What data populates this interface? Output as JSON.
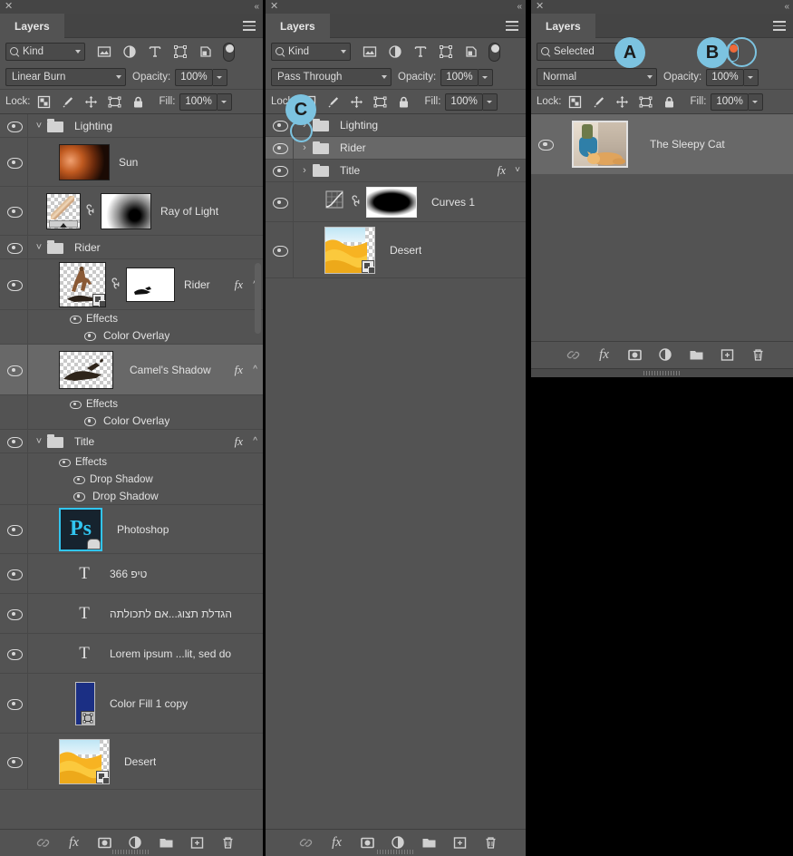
{
  "panels": [
    {
      "id": "panel1",
      "titlebar": {
        "close": "✕",
        "collapse": "«"
      },
      "tab": {
        "label": "Layers",
        "menu_icon": "hamburger-menu-icon"
      },
      "filter": {
        "kind_label": "Kind",
        "search_icon": "search-icon",
        "icons": [
          "pixel-layer-filter-icon",
          "adjustment-layer-filter-icon",
          "type-layer-filter-icon",
          "shape-layer-filter-icon",
          "smart-object-filter-icon"
        ],
        "toggle_on": false
      },
      "blend": {
        "mode": "Linear Burn",
        "opacity_label": "Opacity:",
        "opacity_value": "100%"
      },
      "lock": {
        "label": "Lock:",
        "icons": [
          "lock-transparent-pixels-icon",
          "lock-image-pixels-icon",
          "lock-position-icon",
          "lock-artboard-nesting-icon",
          "lock-all-icon"
        ],
        "fill_label": "Fill:",
        "fill_value": "100%"
      },
      "rows": [
        {
          "kind": "group",
          "name": "Lighting",
          "expanded": true,
          "visible": true,
          "selected": false
        },
        {
          "kind": "image",
          "name": "Sun",
          "visible": true,
          "selected": false,
          "thumb": "sun-thumbnail"
        },
        {
          "kind": "masked",
          "name": "Ray of Light",
          "visible": true,
          "selected": false,
          "thumb": "ray-of-light-thumbnail",
          "mask": "radial-gradient-mask"
        },
        {
          "kind": "group",
          "name": "Rider",
          "expanded": true,
          "visible": true,
          "selected": false
        },
        {
          "kind": "masked",
          "name": "Rider",
          "visible": true,
          "selected": false,
          "fx": "fx",
          "thumb": "camel-rider-thumbnail",
          "mask": "rider-mask"
        },
        {
          "kind": "sub",
          "name": "Effects",
          "visible": true,
          "indent": 1
        },
        {
          "kind": "sub",
          "name": "Color Overlay",
          "visible": true,
          "indent": 2
        },
        {
          "kind": "image",
          "name": "Camel's Shadow",
          "visible": true,
          "selected": true,
          "fx": "fx",
          "thumb": "camel-shadow-thumbnail"
        },
        {
          "kind": "sub",
          "name": "Effects",
          "visible": true,
          "indent": 1
        },
        {
          "kind": "sub",
          "name": "Color Overlay",
          "visible": true,
          "indent": 2
        },
        {
          "kind": "group",
          "name": "Title",
          "expanded": true,
          "visible": true,
          "selected": false,
          "fx": "fx"
        },
        {
          "kind": "sub",
          "name": "Effects",
          "visible": true,
          "indent": 1
        },
        {
          "kind": "sub",
          "name": "Drop Shadow",
          "visible": true,
          "indent": 2
        },
        {
          "kind": "sub",
          "name": "Drop Shadow",
          "visible": true,
          "indent": 2
        },
        {
          "kind": "image",
          "name": "Photoshop",
          "visible": true,
          "selected": false,
          "thumb": "photoshop-logo-thumbnail"
        },
        {
          "kind": "type",
          "name": "טיפ 366",
          "visible": true,
          "selected": false
        },
        {
          "kind": "type",
          "name": "הגדלת תצוג...אם לתכולתה",
          "visible": true,
          "selected": false
        },
        {
          "kind": "type",
          "name": "Lorem ipsum ...lit, sed do",
          "visible": true,
          "selected": false
        },
        {
          "kind": "colorfill",
          "name": "Color Fill 1 copy",
          "visible": true,
          "selected": false,
          "color": "#1b2f84"
        },
        {
          "kind": "image",
          "name": "Desert",
          "visible": true,
          "selected": false,
          "thumb": "desert-thumbnail"
        }
      ],
      "bottom_icons": [
        "link-layers-icon",
        "layer-style-fx-icon",
        "add-layer-mask-icon",
        "new-adjustment-layer-icon",
        "new-group-icon",
        "new-layer-icon",
        "delete-layer-icon"
      ]
    },
    {
      "id": "panel2",
      "titlebar": {
        "close": "✕",
        "collapse": "«"
      },
      "tab": {
        "label": "Layers",
        "menu_icon": "hamburger-menu-icon"
      },
      "filter": {
        "kind_label": "Kind",
        "search_icon": "search-icon",
        "icons": [
          "pixel-layer-filter-icon",
          "adjustment-layer-filter-icon",
          "type-layer-filter-icon",
          "shape-layer-filter-icon",
          "smart-object-filter-icon"
        ],
        "toggle_on": false
      },
      "blend": {
        "mode": "Pass Through",
        "opacity_label": "Opacity:",
        "opacity_value": "100%"
      },
      "lock": {
        "label": "Lock:",
        "icons": [
          "lock-transparent-pixels-icon",
          "lock-image-pixels-icon",
          "lock-position-icon",
          "lock-artboard-nesting-icon",
          "lock-all-icon"
        ],
        "fill_label": "Fill:",
        "fill_value": "100%"
      },
      "rows": [
        {
          "kind": "group",
          "name": "Lighting",
          "expanded": false,
          "visible": true,
          "selected": false
        },
        {
          "kind": "group",
          "name": "Rider",
          "expanded": false,
          "visible": true,
          "selected": true
        },
        {
          "kind": "group",
          "name": "Title",
          "expanded": false,
          "visible": true,
          "selected": false,
          "fx": "fx"
        },
        {
          "kind": "curves",
          "name": "Curves 1",
          "visible": true,
          "selected": false,
          "mask": "curves-mask-thumbnail"
        },
        {
          "kind": "image",
          "name": "Desert",
          "visible": true,
          "selected": false,
          "thumb": "desert-thumbnail"
        }
      ],
      "bottom_icons": [
        "link-layers-icon",
        "layer-style-fx-icon",
        "add-layer-mask-icon",
        "new-adjustment-layer-icon",
        "new-group-icon",
        "new-layer-icon",
        "delete-layer-icon"
      ]
    },
    {
      "id": "panel3",
      "titlebar": {
        "close": "✕",
        "collapse": "«"
      },
      "tab": {
        "label": "Layers",
        "menu_icon": "hamburger-menu-icon"
      },
      "filter": {
        "kind_label": "Selected",
        "search_icon": "search-icon",
        "icons": [],
        "toggle_on": true
      },
      "blend": {
        "mode": "Normal",
        "opacity_label": "Opacity:",
        "opacity_value": "100%"
      },
      "lock": {
        "label": "Lock:",
        "icons": [
          "lock-transparent-pixels-icon",
          "lock-image-pixels-icon",
          "lock-position-icon",
          "lock-artboard-nesting-icon",
          "lock-all-icon"
        ],
        "fill_label": "Fill:",
        "fill_value": "100%"
      },
      "rows": [
        {
          "kind": "image",
          "name": "The Sleepy Cat",
          "visible": true,
          "selected": true,
          "thumb": "sleepy-cat-thumbnail"
        }
      ],
      "bottom_icons": [
        "link-layers-icon",
        "layer-style-fx-icon",
        "add-layer-mask-icon",
        "new-adjustment-layer-icon",
        "new-group-icon",
        "new-layer-icon",
        "delete-layer-icon"
      ]
    }
  ],
  "annotations": [
    {
      "label": "A",
      "target": "filter-type-dropdown"
    },
    {
      "label": "B",
      "target": "filter-toggle-switch"
    },
    {
      "label": "C",
      "target": "group-expand-arrow"
    }
  ],
  "colors": {
    "panel_bg": "#535353",
    "header_bg": "#454545",
    "row_selected": "#686868",
    "text": "#e2e2e2",
    "badge": "#7cc3e0",
    "toggle_on": "#ee6a3a"
  }
}
